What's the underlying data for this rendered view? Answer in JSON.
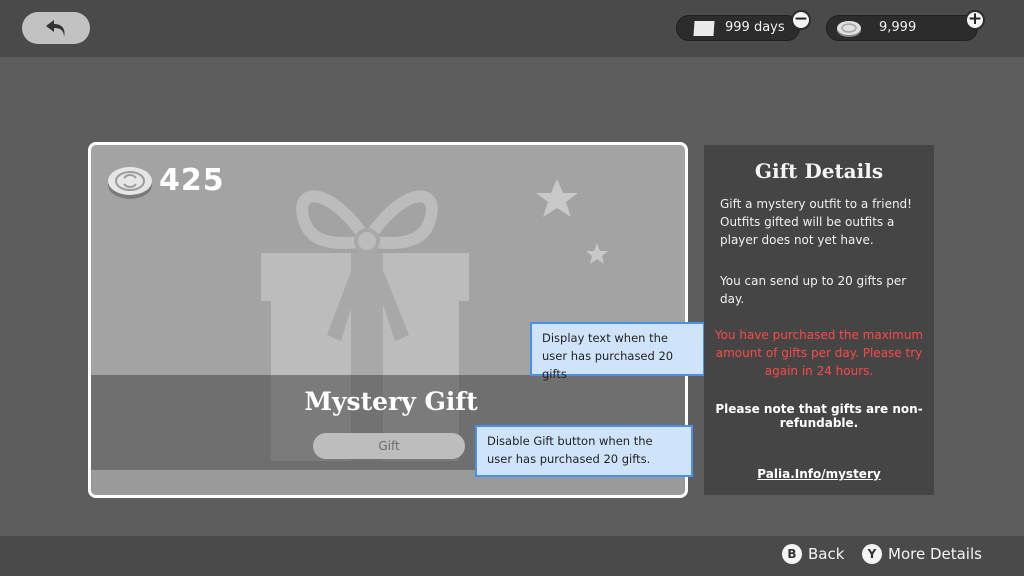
{
  "header": {
    "days_value": "999 days",
    "coins_value": "9,999",
    "days_minus_label": "−",
    "coins_plus_label": "+"
  },
  "item": {
    "price": "425",
    "name": "Mystery Gift",
    "gift_button_label": "Gift"
  },
  "annotations": {
    "display_text_note": "Display text when the user has purchased 20 gifts",
    "disable_button_note": "Disable Gift button when the user has purchased 20 gifts."
  },
  "details": {
    "title": "Gift Details",
    "description": "Gift a mystery outfit to a friend! Outfits gifted will be outfits a player does not yet have.",
    "limit_text": "You can send up to 20 gifts per day.",
    "warning_text": "You have purchased the maximum amount of gifts per day. Please try again in 24 hours.",
    "refund_note": "Please note that gifts are non-refundable.",
    "link_text": "Palia.Info/mystery"
  },
  "footer": {
    "back_glyph": "B",
    "back_label": "Back",
    "more_glyph": "Y",
    "more_label": "More Details"
  },
  "colors": {
    "warning": "#ff4848",
    "annotation_border": "#4d8ee9",
    "annotation_fill": "#cfe3fb"
  }
}
